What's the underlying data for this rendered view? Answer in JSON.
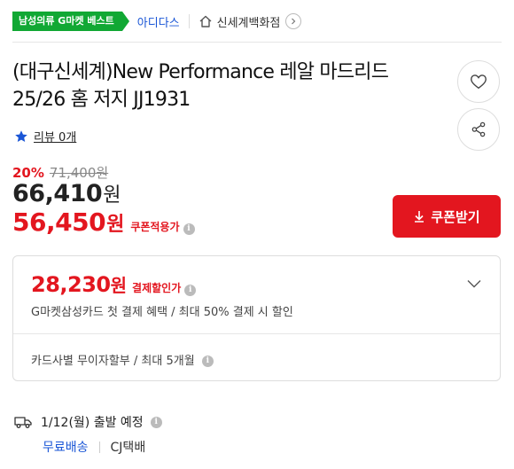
{
  "header": {
    "badge": "남성의류 G마켓 베스트",
    "brand": "아디다스",
    "store": "신세계백화점"
  },
  "product": {
    "title": "(대구신세계)New Performance 레알 마드리드 25/26 홈 저지 JJ1931",
    "review_label": "리뷰 0개"
  },
  "price": {
    "discount_rate": "20%",
    "original": "71,400원",
    "sale_number": "66,410",
    "sale_unit": "원",
    "coupon_number": "56,450",
    "coupon_unit": "원",
    "coupon_label": "쿠폰적용가",
    "coupon_button": "쿠폰받기"
  },
  "payment": {
    "amount_number": "28,230",
    "amount_unit": "원",
    "label": "결제할인가",
    "description": "G마켓삼성카드 첫 결제 혜택 / 최대 50% 결제 시 할인",
    "installment": "카드사별 무이자할부 / 최대 5개월"
  },
  "shipping": {
    "date": "1/12(월) 출발 예정",
    "free": "무료배송",
    "carrier": "CJ택배"
  },
  "icons": {
    "info": "i"
  },
  "colors": {
    "accent_red": "#e3161f",
    "badge_green": "#11a834",
    "link_blue": "#1a56d6"
  }
}
